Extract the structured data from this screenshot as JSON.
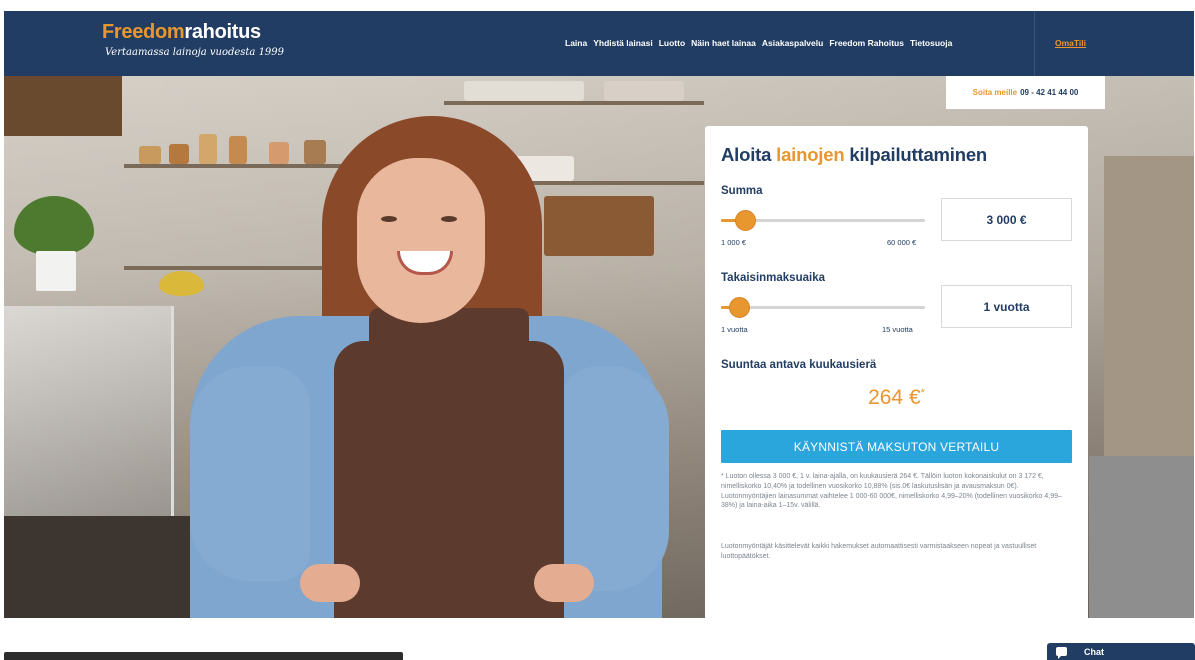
{
  "brand": {
    "name_accent": "Freedom",
    "name_rest": "rahoitus",
    "tagline": "Vertaamassa lainoja vuodesta 1999"
  },
  "nav": {
    "items": [
      "Laina",
      "Yhdistä lainasi",
      "Luotto",
      "Näin haet lainaa",
      "Asiakaspalvelu",
      "Freedom Rahoitus",
      "Tietosuoja"
    ],
    "account": "OmaTili"
  },
  "phone": {
    "label": "Soita meille",
    "number": "09 - 42 41 44 00"
  },
  "calculator": {
    "title_start": "Aloita ",
    "title_highlight": "lainojen",
    "title_end": " kilpailuttaminen",
    "amount": {
      "label": "Summa",
      "min": "1 000 €",
      "max": "60 000 €",
      "value": "3 000 €",
      "fraction": 0.034
    },
    "term": {
      "label": "Takaisinmaksuaika",
      "min": "1 vuotta",
      "max": "15 vuotta",
      "value": "1 vuotta",
      "fraction": 0.0
    },
    "payment_label": "Suuntaa antava kuukausierä",
    "payment_value": "264 €",
    "payment_mark": "*",
    "cta": "KÄYNNISTÄ MAKSUTON VERTAILU",
    "fine_print_1": "* Luoton ollessa 3 000 €, 1 v. laina-ajalla, on kuukausierä 264 €. Tällöin luoton kokonaiskulut on 3 172 €, nimelliskorko 10,40% ja todellinen vuosikorko 10,88% (sis.0€ laskutuslisän ja avausmaksun 0€). Luotonmyöntäjien lainasummat vaihtelee 1 000-60 000€, nimelliskorko 4,99–20% (todellinen vuosikorko 4,99–38%) ja laina-aika 1–15v. välillä.",
    "fine_print_2": "Luotonmyöntäjät käsittelevät kaikki hakemukset automaattisesti varmistaakseen nopeat ja vastuulliset luottopäätökset."
  },
  "bottom": {
    "chat_label": "Chat"
  },
  "colors": {
    "navy": "#223d63",
    "orange": "#e8962e",
    "cta_blue": "#2aa6dd"
  }
}
